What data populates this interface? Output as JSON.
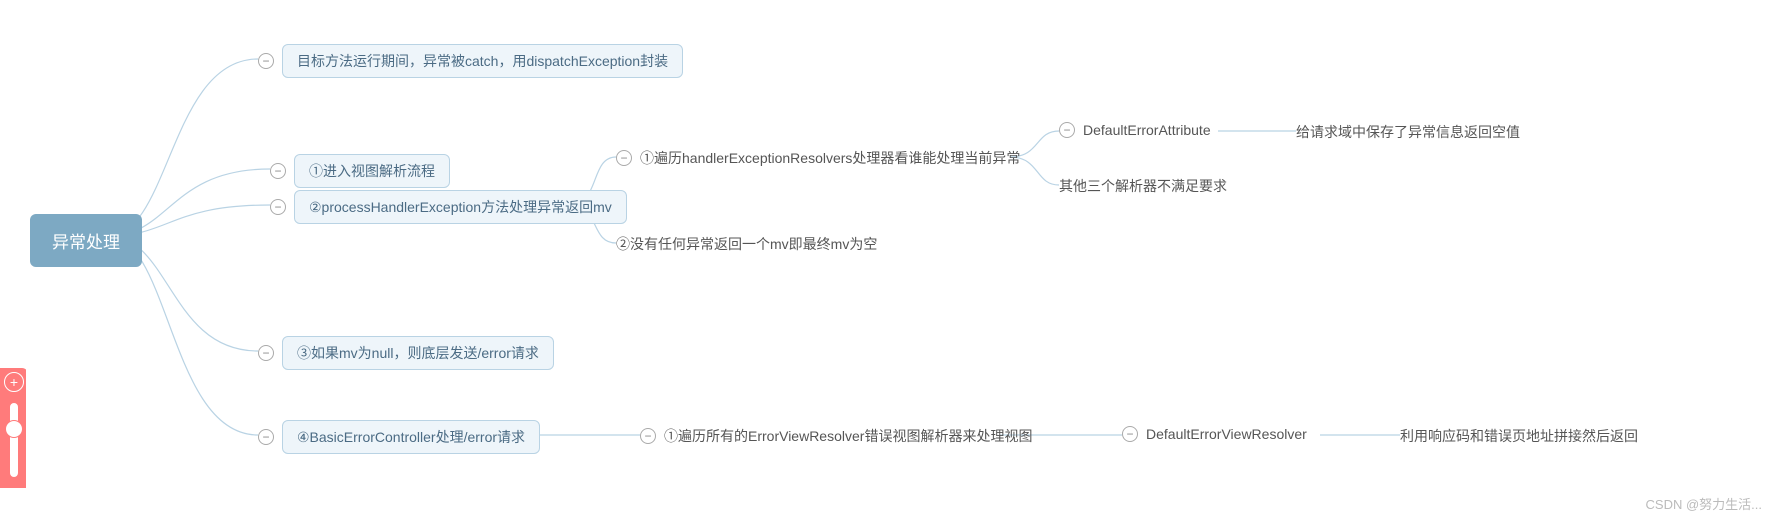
{
  "root": {
    "label": "异常处理"
  },
  "level1": {
    "n1": {
      "label": "目标方法运行期间，异常被catch，用dispatchException封装"
    },
    "n2a": {
      "label": "①进入视图解析流程"
    },
    "n2b": {
      "label": "②processHandlerException方法处理异常返回mv"
    },
    "n3": {
      "label": "③如果mv为null，则底层发送/error请求"
    },
    "n4": {
      "label": "④BasicErrorController处理/error请求"
    }
  },
  "level2": {
    "n2b_1": {
      "label": "①遍历handlerExceptionResolvers处理器看谁能处理当前异常"
    },
    "n2b_2": {
      "label": "②没有任何异常返回一个mv即最终mv为空"
    },
    "n4_1": {
      "label": "①遍历所有的ErrorViewResolver错误视图解析器来处理视图"
    }
  },
  "level3": {
    "dea": {
      "label": "DefaultErrorAttribute"
    },
    "other": {
      "label": "其他三个解析器不满足要求"
    },
    "devr": {
      "label": "DefaultErrorViewResolver"
    }
  },
  "level4": {
    "dea_r": {
      "label": "给请求域中保存了异常信息返回空值"
    },
    "devr_r": {
      "label": "利用响应码和错误页地址拼接然后返回"
    }
  },
  "watermark": "CSDN @努力生活..."
}
